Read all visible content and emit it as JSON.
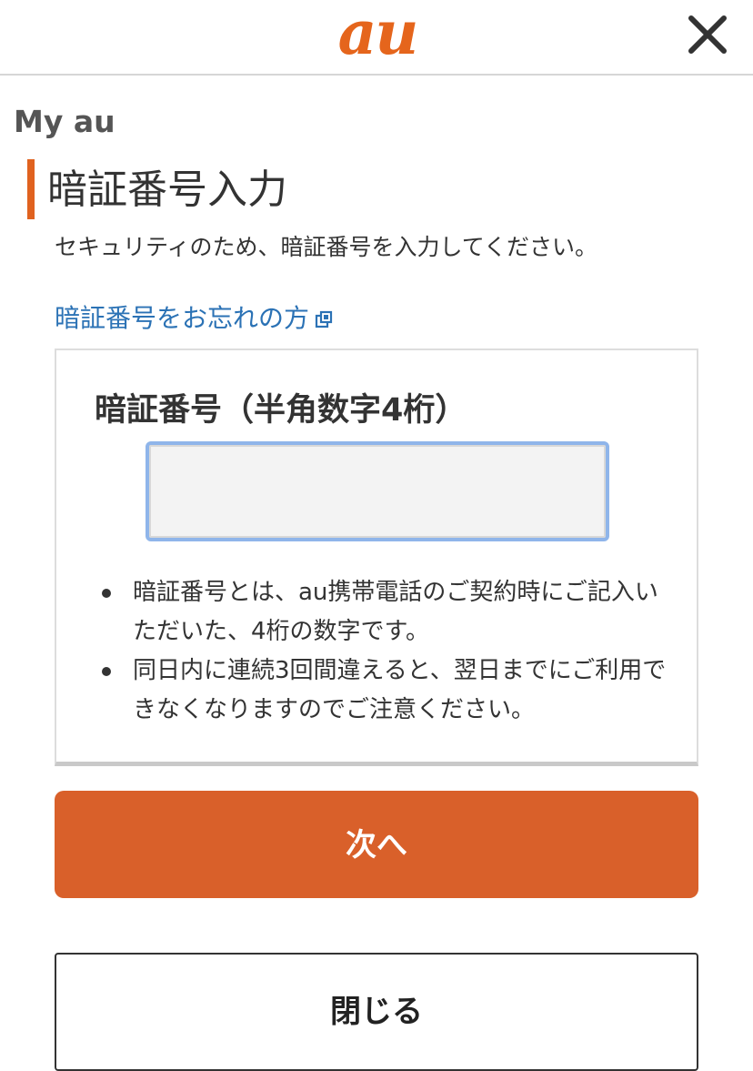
{
  "header": {
    "logo_text": "au",
    "logo_color": "#e5651c",
    "close_icon": "close-x-icon"
  },
  "section_label": "My au",
  "page": {
    "title": "暗証番号入力",
    "description": "セキュリティのため、暗証番号を入力してください。",
    "forgot_link": "暗証番号をお忘れの方",
    "forgot_link_icon": "external-link-icon"
  },
  "form": {
    "pin_label": "暗証番号（半角数字4桁）",
    "pin_value": "",
    "notes": [
      "暗証番号とは、au携帯電話のご契約時にご記入いただいた、4桁の数字です。",
      "同日内に連続3回間違えると、翌日までにご利用できなくなりますのでご注意ください。"
    ]
  },
  "buttons": {
    "next_label": "次へ",
    "close_label": "閉じる"
  },
  "colors": {
    "accent": "#d9602a",
    "link": "#2b72b5",
    "input_focus": "#8fb5ea"
  }
}
